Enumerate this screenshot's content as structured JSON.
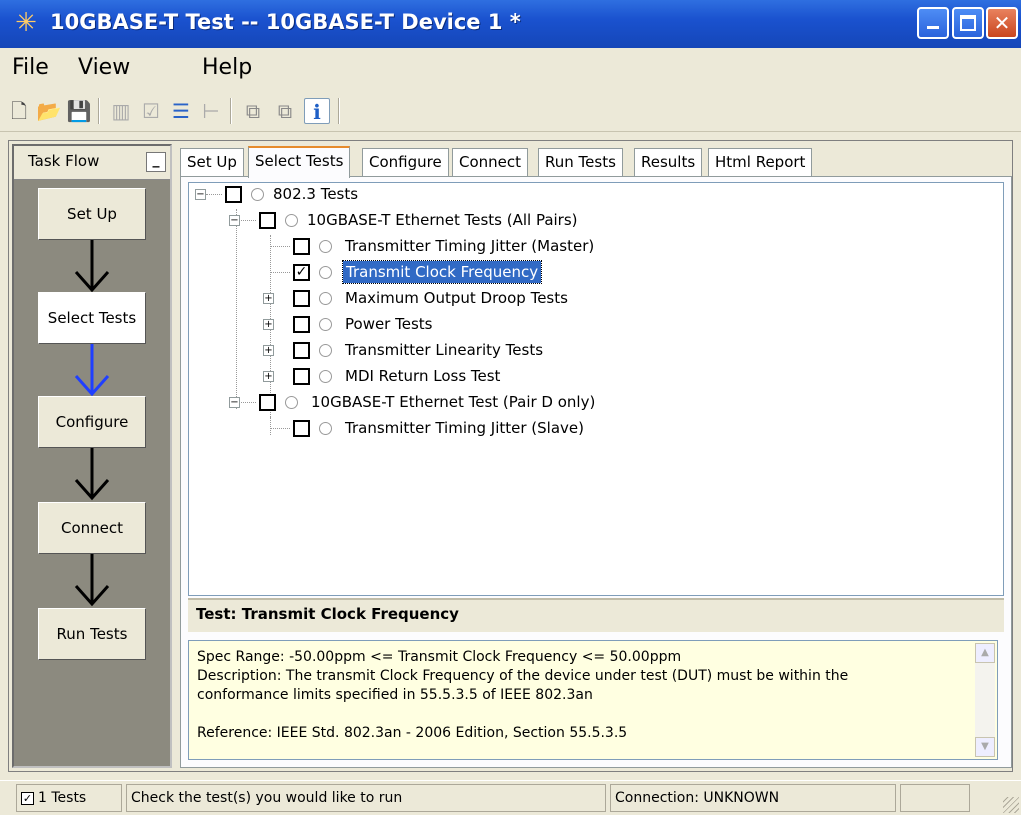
{
  "window": {
    "title": "10GBASE-T Test -- 10GBASE-T Device 1 *"
  },
  "menu": {
    "file": "File",
    "view": "View",
    "help": "Help"
  },
  "taskflow": {
    "title": "Task Flow",
    "steps": [
      "Set Up",
      "Select Tests",
      "Configure",
      "Connect",
      "Run Tests"
    ]
  },
  "tabs": [
    "Set Up",
    "Select Tests",
    "Configure",
    "Connect",
    "Run Tests",
    "Results",
    "Html Report"
  ],
  "tree": {
    "root": "802.3 Tests",
    "group1": "10GBASE-T Ethernet Tests (All Pairs)",
    "items1": [
      {
        "label": "Transmitter Timing Jitter (Master)",
        "checked": false
      },
      {
        "label": "Transmit Clock Frequency",
        "checked": true
      },
      {
        "label": "Maximum Output Droop Tests",
        "checked": false
      },
      {
        "label": "Power Tests",
        "checked": false
      },
      {
        "label": "Transmitter Linearity Tests",
        "checked": false
      },
      {
        "label": "MDI Return Loss Test",
        "checked": false
      }
    ],
    "group2": "10GBASE-T Ethernet Test (Pair D only)",
    "items2": [
      {
        "label": "Transmitter Timing Jitter (Slave)",
        "checked": false
      }
    ]
  },
  "detail": {
    "title": "Test: Transmit Clock Frequency",
    "spec": "Spec Range: -50.00ppm <= Transmit Clock Frequency <= 50.00ppm",
    "description": "Description: The transmit Clock Frequency of the device under test (DUT) must be within the conformance limits specified in 55.5.3.5 of IEEE 802.3an",
    "reference": "Reference: IEEE Std. 802.3an - 2006 Edition, Section 55.5.3.5"
  },
  "status": {
    "tests": "1 Tests",
    "message": "Check the test(s) you would like to run",
    "connection": "Connection: UNKNOWN"
  },
  "colors": {
    "title_bar": "#1a52cf",
    "selection": "#316ac5",
    "active_flow_arrow": "#1f3fff",
    "info_box": "#ffffe1"
  }
}
